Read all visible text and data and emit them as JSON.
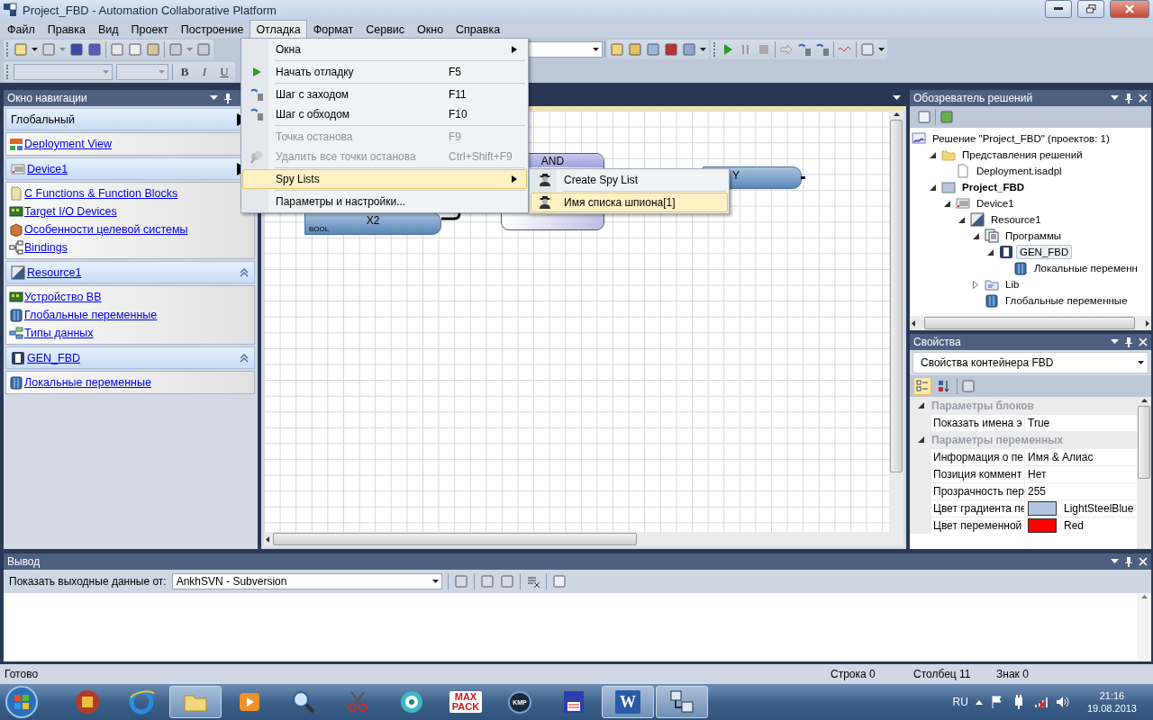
{
  "window": {
    "title": "Project_FBD - Automation Collaborative Platform"
  },
  "menu_bar": [
    {
      "label": "Файл",
      "selected": false
    },
    {
      "label": "Правка",
      "selected": false
    },
    {
      "label": "Вид",
      "selected": false
    },
    {
      "label": "Проект",
      "selected": false
    },
    {
      "label": "Построение",
      "selected": false
    },
    {
      "label": "Отладка",
      "selected": true
    },
    {
      "label": "Формат",
      "selected": false
    },
    {
      "label": "Сервис",
      "selected": false
    },
    {
      "label": "Окно",
      "selected": false
    },
    {
      "label": "Справка",
      "selected": false
    }
  ],
  "debug_menu": [
    {
      "kind": "submenu",
      "label": "Окна",
      "selected": false
    },
    {
      "kind": "separator"
    },
    {
      "kind": "command",
      "label": "Начать отладку",
      "shortcut": "F5",
      "disabled": false,
      "selected": false
    },
    {
      "kind": "separator"
    },
    {
      "kind": "command",
      "label": "Шаг с заходом",
      "shortcut": "F11",
      "disabled": false,
      "selected": false
    },
    {
      "kind": "command",
      "label": "Шаг с обходом",
      "shortcut": "F10",
      "disabled": false,
      "selected": false
    },
    {
      "kind": "separator"
    },
    {
      "kind": "command",
      "label": "Точка останова",
      "shortcut": "F9",
      "disabled": true,
      "selected": false
    },
    {
      "kind": "command",
      "label": "Удалить все точки останова",
      "shortcut": "Ctrl+Shift+F9",
      "disabled": true,
      "selected": false
    },
    {
      "kind": "separator"
    },
    {
      "kind": "submenu",
      "label": "Spy Lists",
      "selected": true
    },
    {
      "kind": "separator"
    },
    {
      "kind": "command",
      "label": "Параметры и настройки...",
      "disabled": false,
      "selected": false
    }
  ],
  "spy_lists_menu": [
    {
      "kind": "command",
      "label": "Create Spy List",
      "selected": false
    },
    {
      "kind": "separator"
    },
    {
      "kind": "command",
      "label": "Имя списка шпиона[1]",
      "selected": true
    }
  ],
  "format_toolbar": {
    "buttons": [
      "B",
      "I",
      "U"
    ]
  },
  "navigation": {
    "title": "Окно навигации",
    "sections": [
      {
        "header": {
          "label": "Глобальный",
          "link": false,
          "kind": "none"
        },
        "expanded": false,
        "items": [
          {
            "label": "Deployment View",
            "kind": "deployment"
          }
        ]
      },
      {
        "header": {
          "label": "Device1",
          "link": true,
          "kind": "device"
        },
        "expanded": false,
        "items": [
          {
            "label": "C Functions & Function Blocks",
            "kind": "functions"
          },
          {
            "label": "Target I/O Devices",
            "kind": "board"
          },
          {
            "label": "Особенности целевой системы",
            "kind": "box"
          },
          {
            "label": "Bindings",
            "kind": "bindings"
          }
        ]
      },
      {
        "header": {
          "label": "Resource1",
          "link": true,
          "kind": "resource"
        },
        "expanded": true,
        "items": [
          {
            "label": "Устройство ВВ",
            "kind": "board"
          },
          {
            "label": "Глобальные переменные",
            "kind": "variables"
          },
          {
            "label": "Типы данных",
            "kind": "types"
          }
        ]
      },
      {
        "header": {
          "label": "GEN_FBD",
          "link": true,
          "kind": "program"
        },
        "expanded": true,
        "items": [
          {
            "label": "Локальные переменные",
            "kind": "variables"
          }
        ]
      }
    ]
  },
  "diagram": {
    "blocks": [
      {
        "kind": "variable",
        "label": "X2",
        "type": "BOOL"
      },
      {
        "kind": "function",
        "label": "AND"
      },
      {
        "kind": "variable",
        "label": "Y"
      }
    ]
  },
  "solution_explorer": {
    "title": "Обозреватель решений",
    "tree": [
      {
        "label": "Решение \"Project_FBD\"  (проектов: 1)",
        "kind": "solution",
        "bold": false,
        "selected": false,
        "children": [
          {
            "label": "Представления решений",
            "kind": "folder",
            "bold": false,
            "selected": false,
            "expanded": true,
            "children": [
              {
                "label": "Deployment.isadpl",
                "kind": "file",
                "bold": false,
                "selected": false
              }
            ]
          },
          {
            "label": "Project_FBD",
            "kind": "project",
            "bold": true,
            "selected": false,
            "expanded": true,
            "children": [
              {
                "label": "Device1",
                "kind": "device",
                "bold": false,
                "selected": false,
                "expanded": true,
                "children": [
                  {
                    "label": "Resource1",
                    "kind": "resource",
                    "bold": false,
                    "selected": false,
                    "expanded": true,
                    "children": [
                      {
                        "label": "Программы",
                        "kind": "programs",
                        "bold": false,
                        "selected": false,
                        "expanded": true,
                        "children": [
                          {
                            "label": "GEN_FBD",
                            "kind": "program",
                            "bold": false,
                            "selected": true,
                            "expanded": true,
                            "children": [
                              {
                                "label": "Локальные переменн",
                                "kind": "variables",
                                "bold": false,
                                "selected": false
                              }
                            ]
                          }
                        ]
                      },
                      {
                        "label": "Lib",
                        "kind": "library",
                        "bold": false,
                        "selected": false,
                        "expanded": false
                      },
                      {
                        "label": "Глобальные переменные",
                        "kind": "variables",
                        "bold": false,
                        "selected": false
                      }
                    ]
                  }
                ]
              }
            ]
          }
        ]
      }
    ]
  },
  "properties": {
    "title": "Свойства",
    "object": "Свойства контейнера FBD",
    "view_buttons": [
      {
        "kind": "categorized",
        "selected": true
      },
      {
        "kind": "alphabetical",
        "selected": false
      }
    ],
    "categories": [
      {
        "label": "Параметры блоков",
        "expanded": true,
        "rows": [
          {
            "name": "Показать имена э",
            "value": "True"
          }
        ]
      },
      {
        "label": "Параметры переменных",
        "expanded": true,
        "rows": [
          {
            "name": "Информация о пе",
            "value": "Имя & Алиас"
          },
          {
            "name": "Позиция коммент",
            "value": "Нет"
          },
          {
            "name": "Прозрачность пер",
            "value": "255"
          },
          {
            "name": "Цвет градиента пе",
            "value": "LightSteelBlue",
            "color": "#b0c4de"
          },
          {
            "name": "Цвет переменной",
            "value": "Red",
            "color": "#ff0000"
          }
        ]
      }
    ]
  },
  "output": {
    "title": "Вывод",
    "source_label": "Показать выходные данные от:",
    "source": "AnkhSVN - Subversion"
  },
  "status_bar": {
    "text": "Готово",
    "line": "Строка 0",
    "column": "Столбец 11",
    "char": "Знак 0"
  },
  "taskbar": {
    "apps": [
      {
        "kind": "app",
        "selected": false
      },
      {
        "kind": "browser",
        "selected": false
      },
      {
        "kind": "folder",
        "selected": true
      },
      {
        "kind": "player",
        "selected": false
      },
      {
        "kind": "search",
        "selected": false
      },
      {
        "kind": "scissors",
        "selected": false
      },
      {
        "kind": "ring",
        "selected": false
      },
      {
        "kind": "maxpack",
        "label": "MAX PACK",
        "selected": false
      },
      {
        "kind": "kmp",
        "label": "KMP",
        "selected": false
      },
      {
        "kind": "floppy",
        "selected": false
      },
      {
        "kind": "word",
        "label": "W",
        "selected": true
      },
      {
        "kind": "network",
        "selected": true
      }
    ],
    "language": "RU",
    "time": "21:16",
    "date": "19.08.2013"
  }
}
